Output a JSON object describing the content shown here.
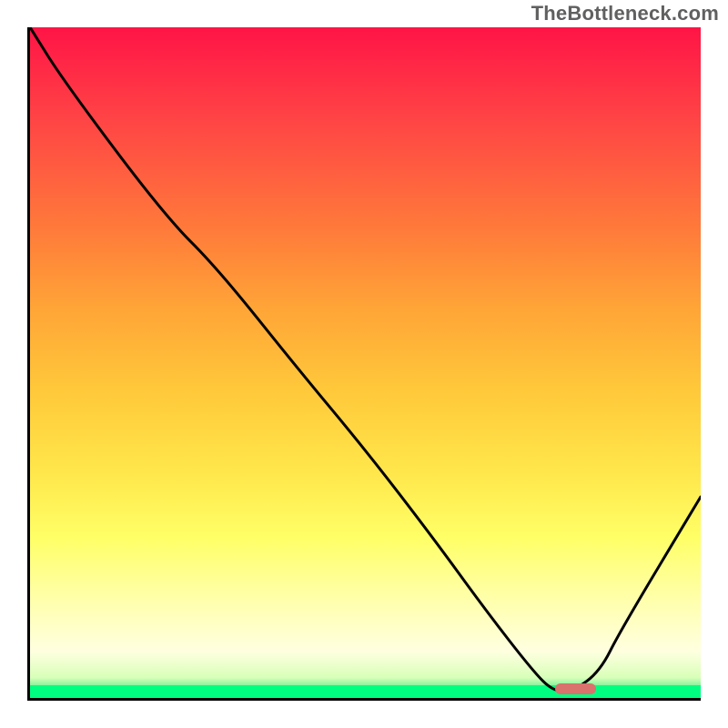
{
  "watermark": "TheBottleneck.com",
  "chart_data": {
    "type": "line",
    "title": "",
    "xlabel": "",
    "ylabel": "",
    "xlim": [
      0,
      100
    ],
    "ylim": [
      0,
      100
    ],
    "series": [
      {
        "name": "curve",
        "x": [
          0,
          5,
          20,
          28,
          40,
          50,
          60,
          68,
          75,
          78,
          81,
          85,
          88,
          100
        ],
        "values": [
          100,
          92,
          72,
          64,
          49,
          37,
          24,
          13,
          4,
          1,
          1,
          4,
          10,
          30
        ]
      }
    ],
    "marker": {
      "x_start": 78,
      "x_end": 84,
      "y": 0.6
    },
    "gradient_stops": [
      {
        "pos": 0.0,
        "color": "#ff1446"
      },
      {
        "pos": 0.14,
        "color": "#ff4545"
      },
      {
        "pos": 0.3,
        "color": "#ff7a3a"
      },
      {
        "pos": 0.42,
        "color": "#ffa537"
      },
      {
        "pos": 0.54,
        "color": "#ffc83a"
      },
      {
        "pos": 0.66,
        "color": "#ffe64a"
      },
      {
        "pos": 0.76,
        "color": "#ffff66"
      },
      {
        "pos": 0.86,
        "color": "#ffffb0"
      },
      {
        "pos": 0.93,
        "color": "#ffffe0"
      },
      {
        "pos": 0.97,
        "color": "#d8ffb8"
      },
      {
        "pos": 1.0,
        "color": "#00e070"
      }
    ],
    "curve_color": "#000000",
    "curve_width": 3,
    "marker_color": "#d9716d"
  }
}
